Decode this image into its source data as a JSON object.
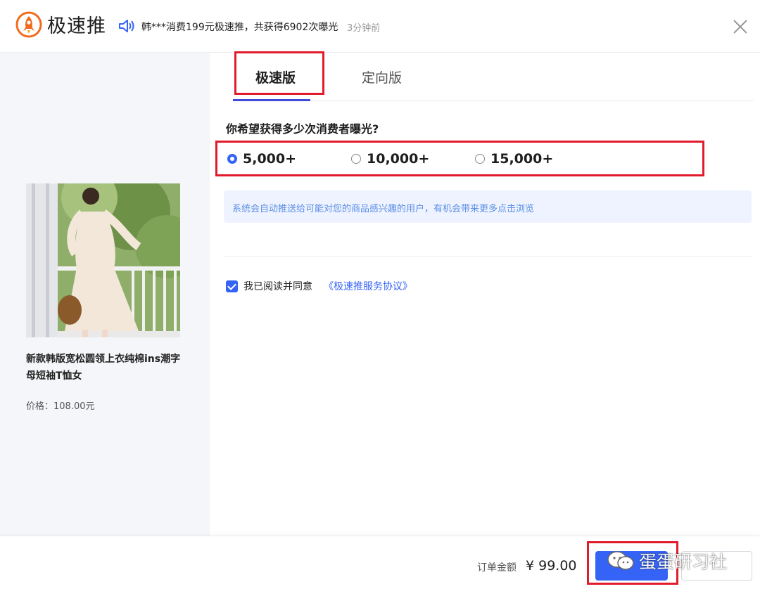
{
  "header": {
    "app_title": "极速推",
    "ticker_text": "韩***消费199元极速推，共获得6902次曝光",
    "ticker_time": "3分钟前"
  },
  "product": {
    "name": "新款韩版宽松圆领上衣纯棉ins潮字母短袖T恤女",
    "price": "价格：108.00元"
  },
  "tabs": [
    {
      "label": "极速版",
      "active": true
    },
    {
      "label": "定向版",
      "active": false
    }
  ],
  "question": "你希望获得多少次消费者曝光?",
  "options": [
    {
      "label": "5,000+",
      "selected": true
    },
    {
      "label": "10,000+",
      "selected": false
    },
    {
      "label": "15,000+",
      "selected": false
    }
  ],
  "notice": "系统会自动推送给可能对您的商品感兴趣的用户，有机会带来更多点击浏览",
  "agreement": {
    "checked": true,
    "text": "我已阅读并同意",
    "link": "《极速推服务协议》"
  },
  "footer": {
    "order_label": "订单金额",
    "order_amount": "¥ 99.00"
  },
  "watermark": "蛋蛋研习社",
  "colors": {
    "accent": "#3563f5",
    "highlight_box": "#e21b2c",
    "notice_bg": "#eef3ff",
    "left_panel_bg": "#f5f6f9"
  }
}
